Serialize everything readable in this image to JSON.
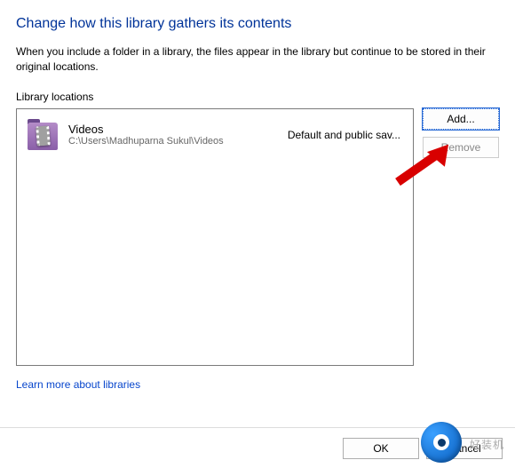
{
  "dialog": {
    "title": "Change how this library gathers its contents",
    "description": "When you include a folder in a library, the files appear in the library but continue to be stored in their original locations.",
    "section_label": "Library locations"
  },
  "locations": [
    {
      "name": "Videos",
      "path": "C:\\Users\\Madhuparna Sukul\\Videos",
      "status": "Default and public sav...",
      "icon": "videos-folder-icon"
    }
  ],
  "buttons": {
    "add": "Add...",
    "remove": "Remove",
    "ok": "OK",
    "cancel": "Cancel"
  },
  "link": {
    "learn_more": "Learn more about libraries"
  },
  "watermark": {
    "text": "好装机"
  }
}
